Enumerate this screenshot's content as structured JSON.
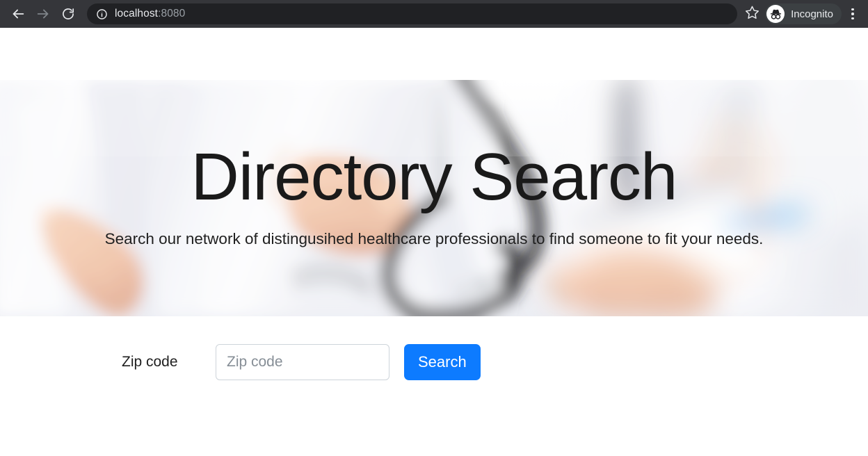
{
  "browser": {
    "back_icon": "back-arrow-icon",
    "forward_icon": "forward-arrow-icon",
    "reload_icon": "reload-icon",
    "site_info_icon": "info-circle-icon",
    "url_host": "localhost",
    "url_port": ":8080",
    "bookmark_icon": "star-icon",
    "incognito_icon": "incognito-hat-glasses-icon",
    "incognito_label": "Incognito",
    "menu_icon": "three-dot-menu-icon",
    "toolbar_bg": "#35363a",
    "omnibox_bg": "#202124",
    "url_text_color": "#e8eaed",
    "url_port_color": "#9aa0a6"
  },
  "hero": {
    "title": "Directory Search",
    "subtitle": "Search our network of distingusihed healthcare professionals to find someone to fit your needs.",
    "image_alt": "blurred-photo-of-doctors-with-stethoscope-and-clipboard",
    "title_color": "#1a1a1a",
    "subtitle_color": "#1f1f1f"
  },
  "search_form": {
    "label": "Zip code",
    "input_value": "",
    "input_placeholder": "Zip code",
    "button_label": "Search",
    "button_color": "#0d7bff",
    "input_border_color": "#ced4da",
    "placeholder_color": "#868e96"
  }
}
